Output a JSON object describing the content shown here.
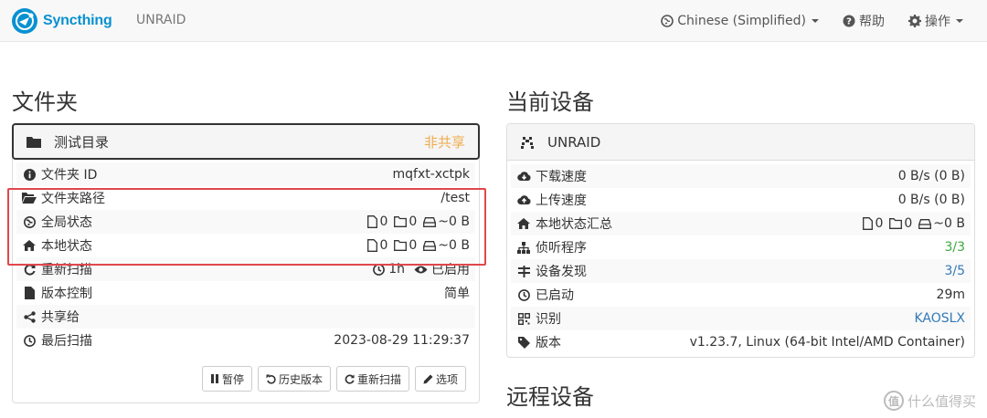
{
  "navbar": {
    "brand": "Syncthing",
    "device_name": "UNRAID",
    "language": "Chinese (Simplified)",
    "help": "帮助",
    "actions": "操作"
  },
  "folders": {
    "title": "文件夹",
    "folder": {
      "name": "测试目录",
      "status": "非共享",
      "rows": [
        {
          "icon": "info-circle-icon",
          "label": "文件夹 ID",
          "value": "mqfxt-xctpk"
        },
        {
          "icon": "folder-open-icon",
          "label": "文件夹路径",
          "value": "/test"
        },
        {
          "icon": "globe-icon",
          "label": "全局状态",
          "files": "0",
          "dirs": "0",
          "size": "~0 B"
        },
        {
          "icon": "home-icon",
          "label": "本地状态",
          "files": "0",
          "dirs": "0",
          "size": "~0 B"
        },
        {
          "icon": "refresh-icon",
          "label": "重新扫描",
          "interval": "1h",
          "watch": "已启用"
        },
        {
          "icon": "file-icon",
          "label": "版本控制",
          "value": "简单"
        },
        {
          "icon": "share-icon",
          "label": "共享给",
          "value": ""
        },
        {
          "icon": "clock-icon",
          "label": "最后扫描",
          "value": "2023-08-29 11:29:37"
        }
      ],
      "buttons": {
        "pause": "暂停",
        "versions": "历史版本",
        "rescan": "重新扫描",
        "options": "选项"
      }
    }
  },
  "this_device": {
    "title": "当前设备",
    "name": "UNRAID",
    "rows": [
      {
        "label": "下载速度",
        "value": "0 B/s (0 B)"
      },
      {
        "label": "上传速度",
        "value": "0 B/s (0 B)"
      },
      {
        "label": "本地状态汇总",
        "files": "0",
        "dirs": "0",
        "size": "~0 B"
      },
      {
        "label": "侦听程序",
        "value": "3/3"
      },
      {
        "label": "设备发现",
        "value": "3/5"
      },
      {
        "label": "已启动",
        "value": "29m"
      },
      {
        "label": "识别",
        "value": "KAOSLX"
      },
      {
        "label": "版本",
        "value": "v1.23.7, Linux (64-bit Intel/AMD Container)"
      }
    ]
  },
  "remote_devices": {
    "title": "远程设备"
  },
  "watermark": {
    "text": "什么值得买",
    "badge": "值"
  },
  "colors": {
    "brand": "#0891d1",
    "warning": "#f0ad4e",
    "success": "#3ca93c",
    "link": "#337ab7",
    "highlight": "#e0474c"
  }
}
